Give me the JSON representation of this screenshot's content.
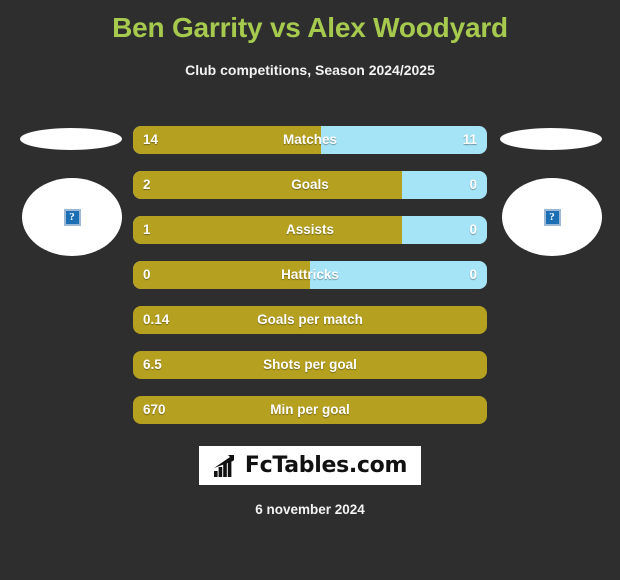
{
  "header": {
    "title": "Ben Garrity vs Alex Woodyard",
    "subtitle": "Club competitions, Season 2024/2025",
    "title_color": "#a6ca4e"
  },
  "theme": {
    "background": "#2e2e2e",
    "home_color": "#b5a020",
    "away_color": "#a5e3f7",
    "text_color": "#ffffff"
  },
  "players": {
    "home": {
      "name": "Ben Garrity",
      "flag_placeholder": "flag-placeholder",
      "photo_placeholder": "broken-image",
      "photo_icon": "?"
    },
    "away": {
      "name": "Alex Woodyard",
      "flag_placeholder": "flag-placeholder",
      "photo_placeholder": "broken-image",
      "photo_icon": "?"
    }
  },
  "chart_data": {
    "type": "bar",
    "title": "Ben Garrity vs Alex Woodyard",
    "subtitle": "Club competitions, Season 2024/2025",
    "orientation": "horizontal-diverging",
    "series": [
      {
        "name": "Ben Garrity",
        "color": "#b5a020"
      },
      {
        "name": "Alex Woodyard",
        "color": "#a5e3f7"
      }
    ],
    "categories": [
      "Matches",
      "Goals",
      "Assists",
      "Hattricks",
      "Goals per match",
      "Shots per goal",
      "Min per goal"
    ],
    "rows": [
      {
        "label": "Matches",
        "home": "14",
        "away": "11",
        "home_pct": 53,
        "has_away": true
      },
      {
        "label": "Goals",
        "home": "2",
        "away": "0",
        "home_pct": 76,
        "has_away": true
      },
      {
        "label": "Assists",
        "home": "1",
        "away": "0",
        "home_pct": 76,
        "has_away": true
      },
      {
        "label": "Hattricks",
        "home": "0",
        "away": "0",
        "home_pct": 50,
        "has_away": true
      },
      {
        "label": "Goals per match",
        "home": "0.14",
        "away": "",
        "home_pct": 100,
        "has_away": false
      },
      {
        "label": "Shots per goal",
        "home": "6.5",
        "away": "",
        "home_pct": 100,
        "has_away": false
      },
      {
        "label": "Min per goal",
        "home": "670",
        "away": "",
        "home_pct": 100,
        "has_away": false
      }
    ],
    "grid": false,
    "legend": "none"
  },
  "footer": {
    "logo_text": "FcTables.com",
    "logo_icon": "bar-chart-icon",
    "date": "6 november 2024"
  }
}
